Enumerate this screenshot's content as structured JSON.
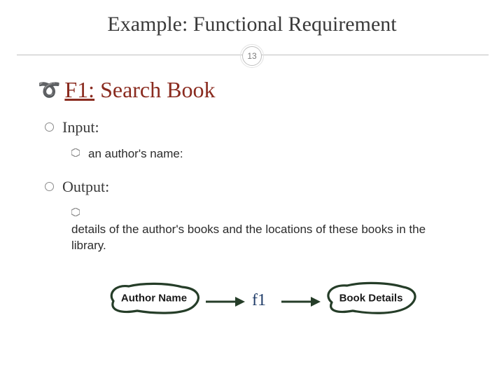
{
  "title": "Example: Functional Requirement",
  "page_number": "13",
  "heading": {
    "bullet_glyph": "➰",
    "id": "F1:",
    "name": "Search Book"
  },
  "input": {
    "label": "Input:",
    "items": [
      "an author's name:"
    ]
  },
  "output": {
    "label": "Output:",
    "items": [
      "details of the author's books and the locations of these books in the library."
    ]
  },
  "diagram": {
    "left_label": "Author Name",
    "function_label": "f1",
    "right_label": "Book Details"
  },
  "colors": {
    "accent": "#8a2b1f",
    "scribble": "#253d28",
    "fn": "#1f3c68"
  }
}
